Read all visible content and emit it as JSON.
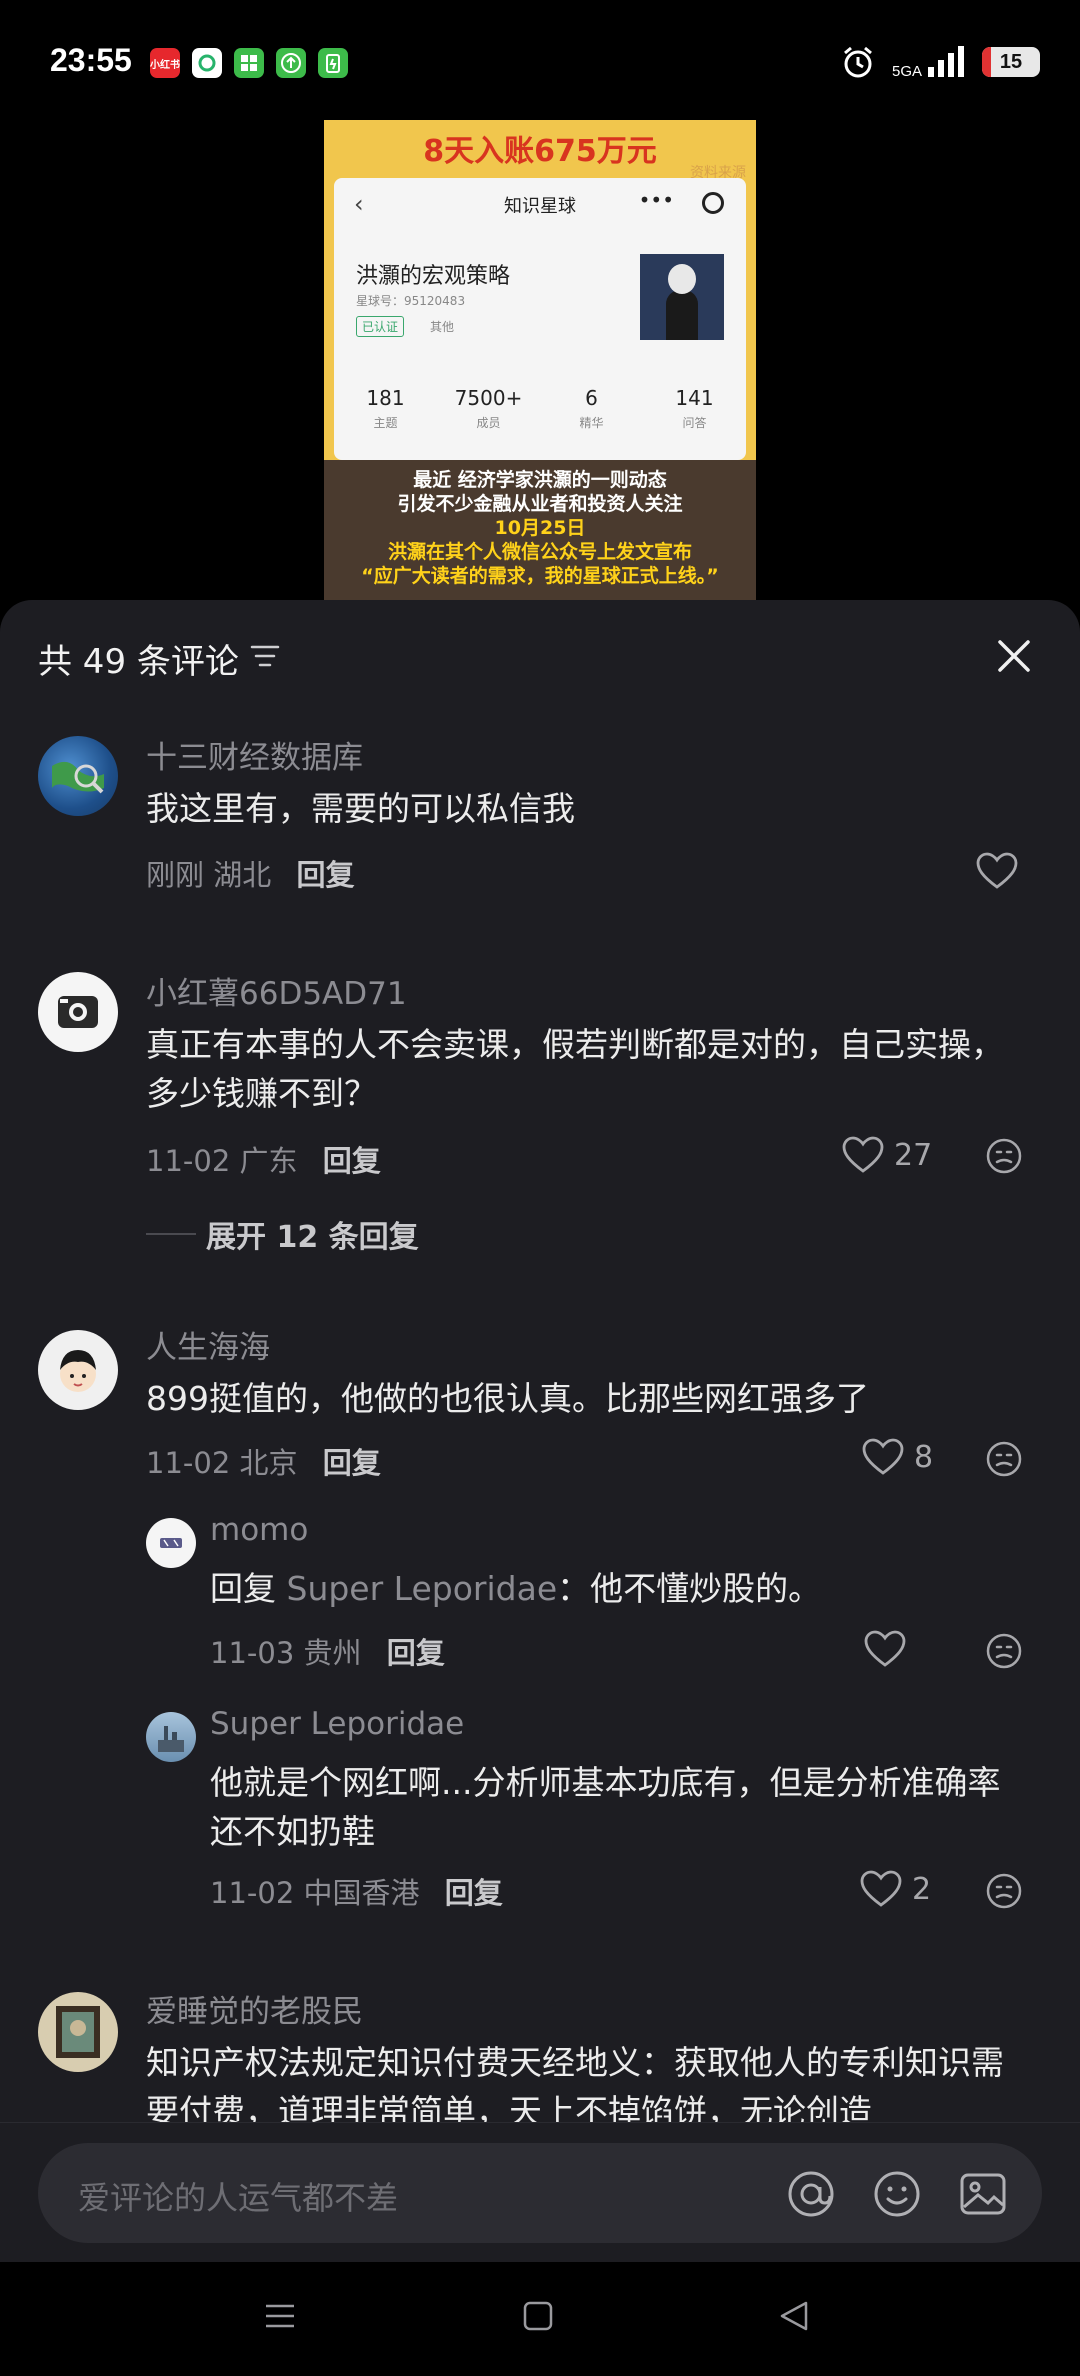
{
  "status_bar": {
    "time": "23:55",
    "network": "5GA",
    "battery": "15",
    "battery_level": 0.15,
    "app_icons": [
      {
        "name": "xiaohongshu-icon",
        "label": "小红书",
        "color": "#e6282d"
      },
      {
        "name": "refresh-app-icon",
        "label": "",
        "color": "#27b36b"
      },
      {
        "name": "grid-app-icon",
        "label": "",
        "color": "#3dbb4a"
      },
      {
        "name": "upload-app-icon",
        "label": "",
        "color": "#3dbb4a"
      },
      {
        "name": "battery-app-icon",
        "label": "",
        "color": "#3dbb4a"
      }
    ]
  },
  "video": {
    "headline": "8天入账675万元",
    "watermark": "资料来源",
    "card": {
      "nav_title": "知识星球",
      "name": "洪灝的宏观策略",
      "planet_id": "星球号：95120483",
      "verified": "已认证",
      "other": "其他",
      "stats": [
        {
          "num": "181",
          "label": "主题"
        },
        {
          "num": "7500+",
          "label": "成员"
        },
        {
          "num": "6",
          "label": "精华"
        },
        {
          "num": "141",
          "label": "问答"
        }
      ]
    },
    "caption": [
      "最近 经济学家洪灝的一则动态",
      "引发不少金融从业者和投资人关注",
      "10月25日",
      "洪灝在其个人微信公众号上发文宣布",
      "“应广大读者的需求，我的星球正式上线。”"
    ]
  },
  "sheet": {
    "title": "共 49 条评论"
  },
  "comments": [
    {
      "user": "十三财经数据库",
      "text": "我这里有，需要的可以私信我",
      "time": "刚刚",
      "location": "湖北",
      "reply_label": "回复",
      "likes": ""
    },
    {
      "user": "小红薯66D5AD71",
      "text": "真正有本事的人不会卖课，假若判断都是对的，自己实操，多少钱赚不到？",
      "time": "11-02",
      "location": "广东",
      "reply_label": "回复",
      "likes": "27",
      "expand": "展开 12 条回复"
    },
    {
      "user": "人生海海",
      "text": "899挺值的，他做的也很认真。比那些网红强多了",
      "time": "11-02",
      "location": "北京",
      "reply_label": "回复",
      "likes": "8",
      "replies": [
        {
          "user": "momo",
          "reply_prefix": "回复",
          "reply_to": "Super Leporidae",
          "text": "：他不懂炒股的。",
          "time": "11-03",
          "location": "贵州",
          "reply_label": "回复",
          "likes": ""
        },
        {
          "user": "Super Leporidae",
          "text": "他就是个网红啊...分析师基本功底有，但是分析准确率还不如扔鞋",
          "time": "11-02",
          "location": "中国香港",
          "reply_label": "回复",
          "likes": "2"
        }
      ]
    },
    {
      "user": "爱睡觉的老股民",
      "text": "知识产权法规定知识付费天经地义：获取他人的专利知识需要付费，道理非常简单，天上不掉馅饼，无论创造"
    }
  ],
  "input": {
    "placeholder": "爱评论的人运气都不差"
  }
}
